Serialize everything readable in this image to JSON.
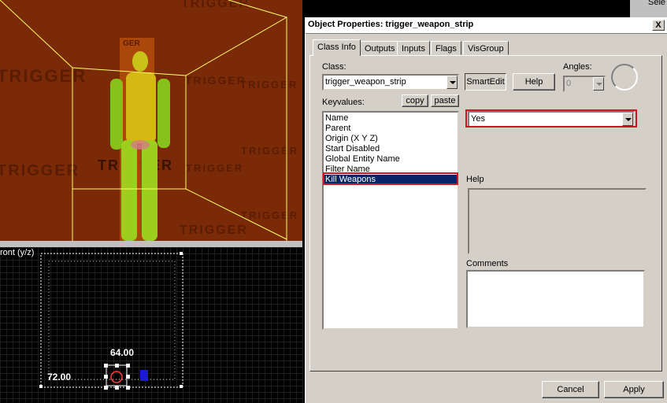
{
  "viewport3d": {
    "trigger_word": "TRIGGER",
    "box_label": "GER",
    "colors": {
      "background": "#7a2a06",
      "model": "#9ccf1d",
      "outline": "#ffff66"
    }
  },
  "viewport2d": {
    "label": "ront (y/z)",
    "width_value": "64.00",
    "height_value": "72.00"
  },
  "right_edge": {
    "label": "Sele"
  },
  "dialog": {
    "title": "Object Properties: trigger_weapon_strip",
    "close_label": "X",
    "tabs": [
      {
        "label": "Class Info",
        "active": true
      },
      {
        "label": "Outputs",
        "active": false
      },
      {
        "label": "Inputs",
        "active": false
      },
      {
        "label": "Flags",
        "active": false
      },
      {
        "label": "VisGroup",
        "active": false
      }
    ],
    "class_label": "Class:",
    "class_value": "trigger_weapon_strip",
    "smartedit_label": "SmartEdit",
    "help_button_label": "Help",
    "angles_label": "Angles:",
    "angles_value": "0",
    "keyvalues_label": "Keyvalues:",
    "copy_label": "copy",
    "paste_label": "paste",
    "keyvalues": [
      "Name",
      "Parent",
      "Origin (X Y Z)",
      "Start Disabled",
      "Global Entity Name",
      "Filter Name",
      "Kill Weapons"
    ],
    "selected_keyvalue": "Kill Weapons",
    "value_select": "Yes",
    "help_label": "Help",
    "comments_label": "Comments",
    "cancel_label": "Cancel",
    "apply_label": "Apply",
    "colors": {
      "highlight": "#d1141f",
      "selection": "#0a246a",
      "face": "#d4d0c8"
    }
  }
}
